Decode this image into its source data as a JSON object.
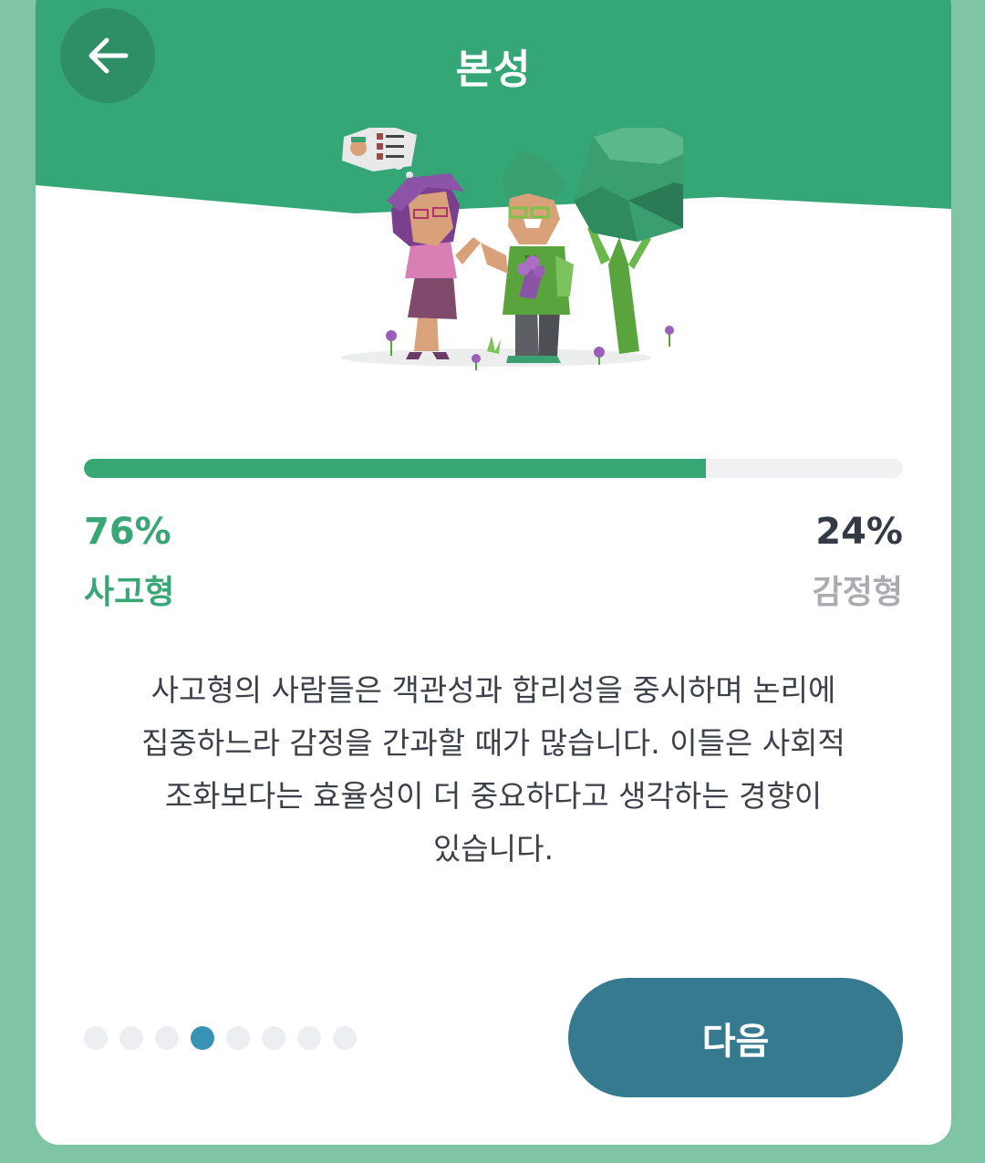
{
  "header": {
    "title": "본성",
    "back_icon": "arrow-left-icon",
    "color": "#35a676"
  },
  "result": {
    "progress_fraction": 0.76,
    "left_percent": "76%",
    "left_label": "사고형",
    "right_percent": "24%",
    "right_label": "감정형",
    "accent_color": "#38a775"
  },
  "description": {
    "lines": [
      "사고형의 사람들은 객관성과 합리성을 중시하며 논리에",
      "집중하느라 감정을 간과할 때가 많습니다. 이들은 사회적",
      "조화보다는 효율성이 더 중요하다고 생각하는 경향이",
      "있습니다."
    ]
  },
  "pagination": {
    "total": 8,
    "active_index": 3,
    "active_color": "#3a91b6"
  },
  "footer": {
    "next_label": "다음",
    "button_color": "#367a90"
  }
}
